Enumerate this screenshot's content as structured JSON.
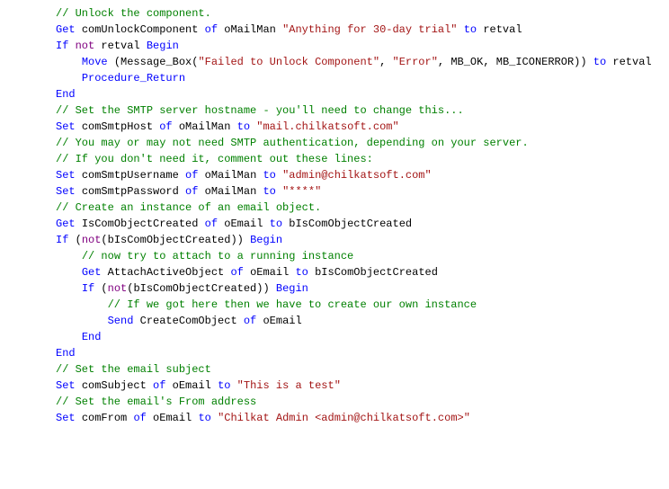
{
  "code": {
    "lines": [
      {
        "indent": 0,
        "segs": [
          {
            "t": "// Unlock the component.",
            "c": "c-comment"
          }
        ]
      },
      {
        "indent": 0,
        "segs": [
          {
            "t": "Get",
            "c": "c-keyword"
          },
          {
            "t": " ",
            "c": "c-black"
          },
          {
            "t": "comUnlockComponent",
            "c": "c-ident"
          },
          {
            "t": " ",
            "c": "c-black"
          },
          {
            "t": "of",
            "c": "c-keyword"
          },
          {
            "t": " ",
            "c": "c-black"
          },
          {
            "t": "oMailMan",
            "c": "c-ident"
          },
          {
            "t": " ",
            "c": "c-black"
          },
          {
            "t": "\"Anything for 30-day trial\"",
            "c": "c-string"
          },
          {
            "t": " ",
            "c": "c-black"
          },
          {
            "t": "to",
            "c": "c-keyword"
          },
          {
            "t": " ",
            "c": "c-black"
          },
          {
            "t": "retval",
            "c": "c-ident"
          }
        ]
      },
      {
        "indent": 0,
        "segs": [
          {
            "t": "If",
            "c": "c-keyword"
          },
          {
            "t": " ",
            "c": "c-black"
          },
          {
            "t": "not",
            "c": "c-purple"
          },
          {
            "t": " ",
            "c": "c-black"
          },
          {
            "t": "retval",
            "c": "c-ident"
          },
          {
            "t": " ",
            "c": "c-black"
          },
          {
            "t": "Begin",
            "c": "c-keyword"
          }
        ]
      },
      {
        "indent": 1,
        "segs": [
          {
            "t": "Move",
            "c": "c-keyword"
          },
          {
            "t": " (",
            "c": "c-black"
          },
          {
            "t": "Message_Box",
            "c": "c-ident"
          },
          {
            "t": "(",
            "c": "c-black"
          },
          {
            "t": "\"Failed to Unlock Component\"",
            "c": "c-string"
          },
          {
            "t": ", ",
            "c": "c-black"
          },
          {
            "t": "\"Error\"",
            "c": "c-string"
          },
          {
            "t": ", ",
            "c": "c-black"
          },
          {
            "t": "MB_OK",
            "c": "c-ident"
          },
          {
            "t": ", ",
            "c": "c-black"
          },
          {
            "t": "MB_ICONERROR",
            "c": "c-ident"
          },
          {
            "t": ")) ",
            "c": "c-black"
          },
          {
            "t": "to",
            "c": "c-keyword"
          },
          {
            "t": " ",
            "c": "c-black"
          },
          {
            "t": "retval",
            "c": "c-ident"
          }
        ]
      },
      {
        "indent": 1,
        "segs": [
          {
            "t": "Procedure_Return",
            "c": "c-keyword"
          }
        ]
      },
      {
        "indent": 0,
        "segs": [
          {
            "t": "End",
            "c": "c-keyword"
          }
        ]
      },
      {
        "indent": 0,
        "segs": [
          {
            "t": "",
            "c": "c-black"
          }
        ]
      },
      {
        "indent": 0,
        "segs": [
          {
            "t": "// Set the SMTP server hostname - you'll need to change this...",
            "c": "c-comment"
          }
        ]
      },
      {
        "indent": 0,
        "segs": [
          {
            "t": "Set",
            "c": "c-keyword"
          },
          {
            "t": " ",
            "c": "c-black"
          },
          {
            "t": "comSmtpHost",
            "c": "c-ident"
          },
          {
            "t": " ",
            "c": "c-black"
          },
          {
            "t": "of",
            "c": "c-keyword"
          },
          {
            "t": " ",
            "c": "c-black"
          },
          {
            "t": "oMailMan",
            "c": "c-ident"
          },
          {
            "t": " ",
            "c": "c-black"
          },
          {
            "t": "to",
            "c": "c-keyword"
          },
          {
            "t": " ",
            "c": "c-black"
          },
          {
            "t": "\"mail.chilkatsoft.com\"",
            "c": "c-string"
          }
        ]
      },
      {
        "indent": 0,
        "segs": [
          {
            "t": "",
            "c": "c-black"
          }
        ]
      },
      {
        "indent": 0,
        "segs": [
          {
            "t": "// You may or may not need SMTP authentication, depending on your server.",
            "c": "c-comment"
          }
        ]
      },
      {
        "indent": 0,
        "segs": [
          {
            "t": "// If you don't need it, comment out these lines:",
            "c": "c-comment"
          }
        ]
      },
      {
        "indent": 0,
        "segs": [
          {
            "t": "Set",
            "c": "c-keyword"
          },
          {
            "t": " ",
            "c": "c-black"
          },
          {
            "t": "comSmtpUsername",
            "c": "c-ident"
          },
          {
            "t": " ",
            "c": "c-black"
          },
          {
            "t": "of",
            "c": "c-keyword"
          },
          {
            "t": " ",
            "c": "c-black"
          },
          {
            "t": "oMailMan",
            "c": "c-ident"
          },
          {
            "t": " ",
            "c": "c-black"
          },
          {
            "t": "to",
            "c": "c-keyword"
          },
          {
            "t": " ",
            "c": "c-black"
          },
          {
            "t": "\"admin@chilkatsoft.com\"",
            "c": "c-string"
          }
        ]
      },
      {
        "indent": 0,
        "segs": [
          {
            "t": "Set",
            "c": "c-keyword"
          },
          {
            "t": " ",
            "c": "c-black"
          },
          {
            "t": "comSmtpPassword",
            "c": "c-ident"
          },
          {
            "t": " ",
            "c": "c-black"
          },
          {
            "t": "of",
            "c": "c-keyword"
          },
          {
            "t": " ",
            "c": "c-black"
          },
          {
            "t": "oMailMan",
            "c": "c-ident"
          },
          {
            "t": " ",
            "c": "c-black"
          },
          {
            "t": "to",
            "c": "c-keyword"
          },
          {
            "t": " ",
            "c": "c-black"
          },
          {
            "t": "\"****\"",
            "c": "c-string"
          }
        ]
      },
      {
        "indent": 0,
        "segs": [
          {
            "t": "",
            "c": "c-black"
          }
        ]
      },
      {
        "indent": 0,
        "segs": [
          {
            "t": "// Create an instance of an email object.",
            "c": "c-comment"
          }
        ]
      },
      {
        "indent": 0,
        "segs": [
          {
            "t": "Get",
            "c": "c-keyword"
          },
          {
            "t": " ",
            "c": "c-black"
          },
          {
            "t": "IsComObjectCreated",
            "c": "c-ident"
          },
          {
            "t": " ",
            "c": "c-black"
          },
          {
            "t": "of",
            "c": "c-keyword"
          },
          {
            "t": " ",
            "c": "c-black"
          },
          {
            "t": "oEmail",
            "c": "c-ident"
          },
          {
            "t": " ",
            "c": "c-black"
          },
          {
            "t": "to",
            "c": "c-keyword"
          },
          {
            "t": " ",
            "c": "c-black"
          },
          {
            "t": "bIsComObjectCreated",
            "c": "c-ident"
          }
        ]
      },
      {
        "indent": 0,
        "segs": [
          {
            "t": "",
            "c": "c-black"
          }
        ]
      },
      {
        "indent": 0,
        "segs": [
          {
            "t": "If",
            "c": "c-keyword"
          },
          {
            "t": " (",
            "c": "c-black"
          },
          {
            "t": "not",
            "c": "c-purple"
          },
          {
            "t": "(",
            "c": "c-black"
          },
          {
            "t": "bIsComObjectCreated",
            "c": "c-ident"
          },
          {
            "t": ")) ",
            "c": "c-black"
          },
          {
            "t": "Begin",
            "c": "c-keyword"
          }
        ]
      },
      {
        "indent": 1,
        "segs": [
          {
            "t": "// now try to attach to a running instance",
            "c": "c-comment"
          }
        ]
      },
      {
        "indent": 1,
        "segs": [
          {
            "t": "Get",
            "c": "c-keyword"
          },
          {
            "t": " ",
            "c": "c-black"
          },
          {
            "t": "AttachActiveObject",
            "c": "c-ident"
          },
          {
            "t": " ",
            "c": "c-black"
          },
          {
            "t": "of",
            "c": "c-keyword"
          },
          {
            "t": " ",
            "c": "c-black"
          },
          {
            "t": "oEmail",
            "c": "c-ident"
          },
          {
            "t": " ",
            "c": "c-black"
          },
          {
            "t": "to",
            "c": "c-keyword"
          },
          {
            "t": " ",
            "c": "c-black"
          },
          {
            "t": "bIsComObjectCreated",
            "c": "c-ident"
          }
        ]
      },
      {
        "indent": 0,
        "segs": [
          {
            "t": "",
            "c": "c-black"
          }
        ]
      },
      {
        "indent": 1,
        "segs": [
          {
            "t": "If",
            "c": "c-keyword"
          },
          {
            "t": " (",
            "c": "c-black"
          },
          {
            "t": "not",
            "c": "c-purple"
          },
          {
            "t": "(",
            "c": "c-black"
          },
          {
            "t": "bIsComObjectCreated",
            "c": "c-ident"
          },
          {
            "t": ")) ",
            "c": "c-black"
          },
          {
            "t": "Begin",
            "c": "c-keyword"
          }
        ]
      },
      {
        "indent": 2,
        "segs": [
          {
            "t": "// If we got here then we have to create our own instance",
            "c": "c-comment"
          }
        ]
      },
      {
        "indent": 2,
        "segs": [
          {
            "t": "Send",
            "c": "c-keyword"
          },
          {
            "t": " ",
            "c": "c-black"
          },
          {
            "t": "CreateComObject",
            "c": "c-ident"
          },
          {
            "t": " ",
            "c": "c-black"
          },
          {
            "t": "of",
            "c": "c-keyword"
          },
          {
            "t": " ",
            "c": "c-black"
          },
          {
            "t": "oEmail",
            "c": "c-ident"
          }
        ]
      },
      {
        "indent": 1,
        "segs": [
          {
            "t": "End",
            "c": "c-keyword"
          }
        ]
      },
      {
        "indent": 0,
        "segs": [
          {
            "t": "End",
            "c": "c-keyword"
          }
        ]
      },
      {
        "indent": 0,
        "segs": [
          {
            "t": "",
            "c": "c-black"
          }
        ]
      },
      {
        "indent": 0,
        "segs": [
          {
            "t": "// Set the email subject",
            "c": "c-comment"
          }
        ]
      },
      {
        "indent": 0,
        "segs": [
          {
            "t": "Set",
            "c": "c-keyword"
          },
          {
            "t": " ",
            "c": "c-black"
          },
          {
            "t": "comSubject",
            "c": "c-ident"
          },
          {
            "t": " ",
            "c": "c-black"
          },
          {
            "t": "of",
            "c": "c-keyword"
          },
          {
            "t": " ",
            "c": "c-black"
          },
          {
            "t": "oEmail",
            "c": "c-ident"
          },
          {
            "t": " ",
            "c": "c-black"
          },
          {
            "t": "to",
            "c": "c-keyword"
          },
          {
            "t": " ",
            "c": "c-black"
          },
          {
            "t": "\"This is a test\"",
            "c": "c-string"
          }
        ]
      },
      {
        "indent": 0,
        "segs": [
          {
            "t": "",
            "c": "c-black"
          }
        ]
      },
      {
        "indent": 0,
        "segs": [
          {
            "t": "// Set the email's From address",
            "c": "c-comment"
          }
        ]
      },
      {
        "indent": 0,
        "segs": [
          {
            "t": "Set",
            "c": "c-keyword"
          },
          {
            "t": " ",
            "c": "c-black"
          },
          {
            "t": "comFrom",
            "c": "c-ident"
          },
          {
            "t": " ",
            "c": "c-black"
          },
          {
            "t": "of",
            "c": "c-keyword"
          },
          {
            "t": " ",
            "c": "c-black"
          },
          {
            "t": "oEmail",
            "c": "c-ident"
          },
          {
            "t": " ",
            "c": "c-black"
          },
          {
            "t": "to",
            "c": "c-keyword"
          },
          {
            "t": " ",
            "c": "c-black"
          },
          {
            "t": "\"Chilkat Admin <admin@chilkatsoft.com>\"",
            "c": "c-string"
          }
        ]
      }
    ]
  }
}
